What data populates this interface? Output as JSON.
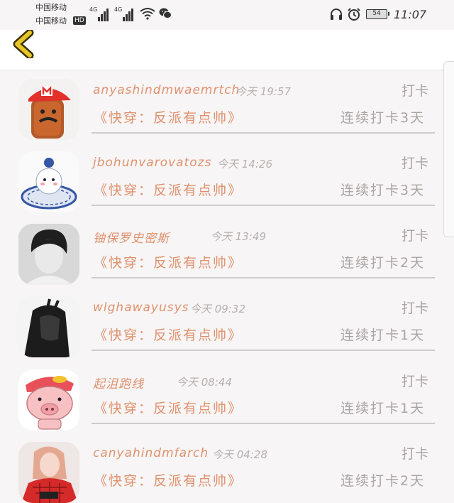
{
  "status_bar": {
    "carrier_1": "中国移动",
    "carrier_2": "中国移动",
    "hd_badge": "HD",
    "signal_1": "4G",
    "signal_2": "4G",
    "battery_level": "54",
    "time": "11:07",
    "icons": [
      "signal-icon",
      "wifi-icon",
      "wechat-icon",
      "headset-icon",
      "alarm-icon",
      "battery-icon"
    ]
  },
  "header": {
    "back_icon": "chevron-left-icon",
    "accent_color": "#e8c52a"
  },
  "theme": {
    "accent_text": "#e0916c",
    "muted_text": "#a9a5a3"
  },
  "items": [
    {
      "name": "anyashindmwaemrtch",
      "time": "今天 19:57",
      "action": "打卡",
      "book": "《快穿：反派有点帅》",
      "streak": "连续打卡3天",
      "avatar": "mustache-cap-avatar"
    },
    {
      "name": "jbohunvarovatozs",
      "time": "今天 14:26",
      "action": "打卡",
      "book": "《快穿：反派有点帅》",
      "streak": "连续打卡3天",
      "avatar": "porcelain-figure-avatar"
    },
    {
      "name": "铀保罗史密斯",
      "time": "今天 13:49",
      "action": "打卡",
      "book": "《快穿：反派有点帅》",
      "streak": "连续打卡2天",
      "avatar": "bw-portrait-avatar"
    },
    {
      "name": "wlghawayusys",
      "time": "今天 09:32",
      "action": "打卡",
      "book": "《快穿：反派有点帅》",
      "streak": "连续打卡1天",
      "avatar": "bw-hair-avatar"
    },
    {
      "name": "起沮跑线",
      "time": "今天 08:44",
      "action": "打卡",
      "book": "《快穿：反派有点帅》",
      "streak": "连续打卡1天",
      "avatar": "cartoon-pig-avatar"
    },
    {
      "name": "canyahindmfarch",
      "time": "今天 04:28",
      "action": "打卡",
      "book": "《快穿：反派有点帅》",
      "streak": "连续打卡2天",
      "avatar": "red-shirt-girl-avatar"
    }
  ]
}
